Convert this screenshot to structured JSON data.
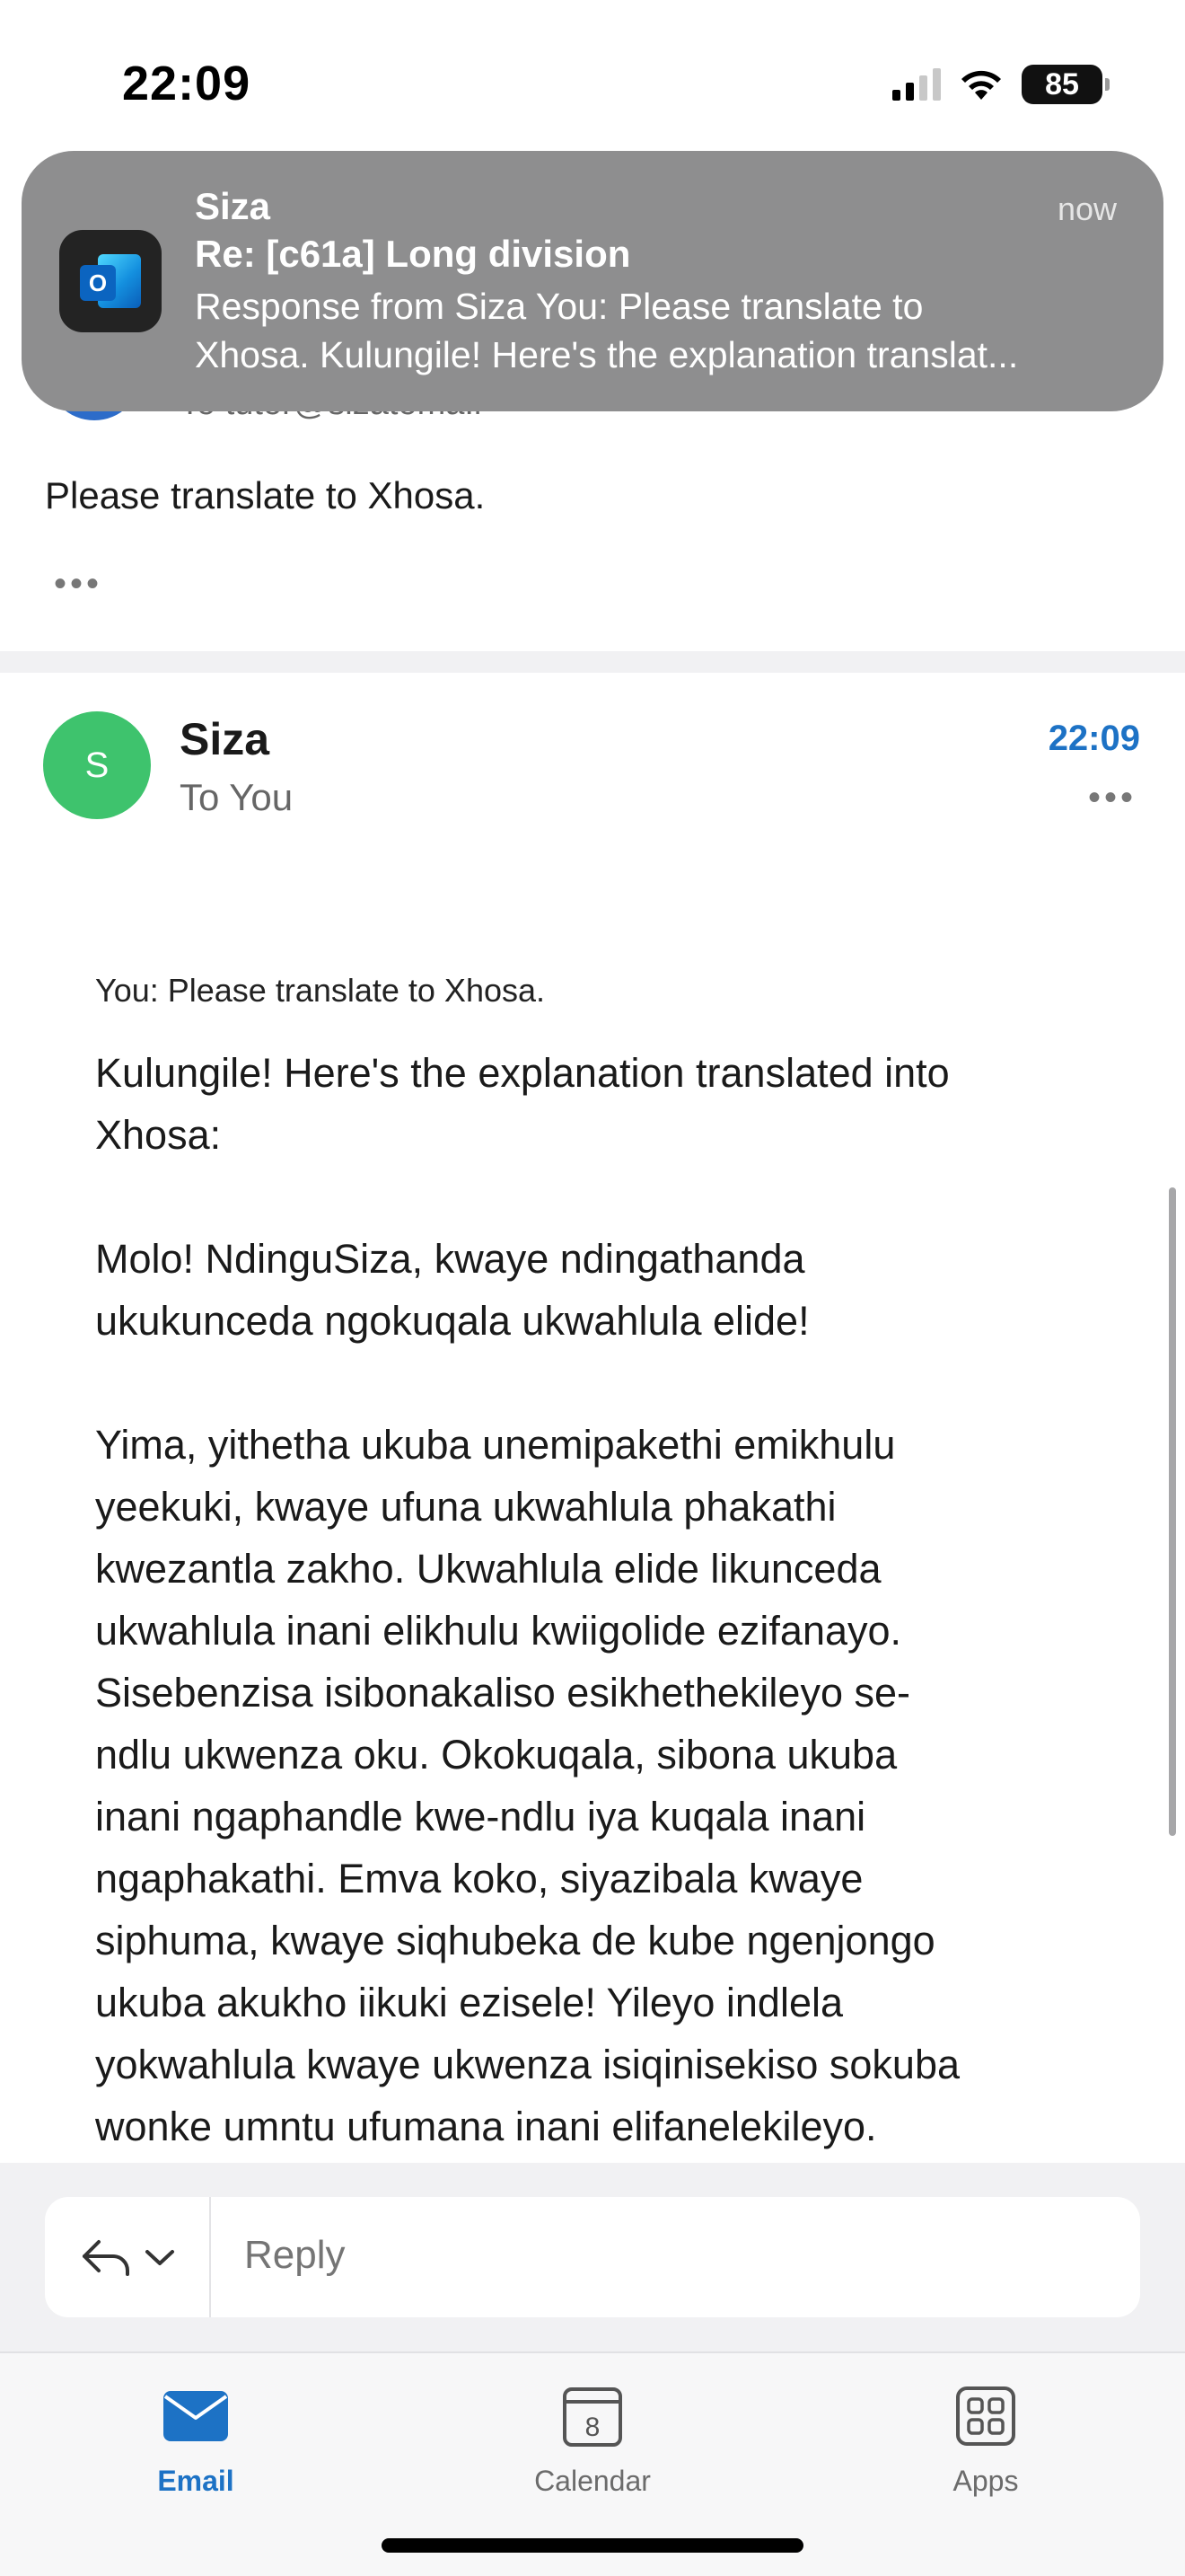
{
  "status_bar": {
    "time": "22:09",
    "battery": "85"
  },
  "notification": {
    "app": "Siza",
    "time": "now",
    "title": "Re: [c61a] Long division",
    "body_line1": "Response from Siza You: Please translate to",
    "body_line2": "Xhosa. Kulungile! Here's the explanation translat...",
    "icon": "outlook-icon",
    "icon_letter": "O"
  },
  "previous_message": {
    "recipient_partial": "To tutor@sizatoma.l",
    "body": "Please translate to Xhosa.",
    "more": "•••"
  },
  "message": {
    "avatar_initial": "S",
    "sender": "Siza",
    "recipient": "To You",
    "time": "22:09",
    "more": "•••",
    "quote": "You: Please translate to Xhosa.",
    "paragraphs": [
      "Kulungile! Here's the explanation translated into\nXhosa:",
      "Molo! NdinguSiza, kwaye ndingathanda\nukukunceda ngokuqala ukwahlula elide!",
      "Yima, yithetha ukuba unemipakethi emikhulu\nyeekuki, kwaye ufuna ukwahlula phakathi\nkwezantla zakho. Ukwahlula elide likunceda\nukwahlula inani elikhulu kwiigolide ezifanayo.\nSisebenzisa isibonakaliso esikhethekileyo se-\nndlu ukwenza oku. Okokuqala, sibona ukuba\ninani ngaphandle kwe-ndlu iya kuqala inani\nngaphakathi. Emva koko, siyazibala kwaye\nsiphuma, kwaye siqhubeka de kube ngenjongo\nukuba akukho iikuki ezisele! Yileyo indlela\nyokwahlula kwaye ukwenza isiqinisekiso sokuba\nwonke umntu ufumana inani elifanelekileyo."
    ]
  },
  "reply": {
    "placeholder": "Reply"
  },
  "tabs": [
    {
      "label": "Email",
      "icon": "envelope-icon",
      "active": true
    },
    {
      "label": "Calendar",
      "icon": "calendar-icon",
      "day": "8",
      "active": false
    },
    {
      "label": "Apps",
      "icon": "apps-grid-icon",
      "active": false
    }
  ],
  "colors": {
    "accent": "#1d72c5",
    "avatar": "#3ec36d",
    "notification_bg": "#8e8e8f"
  }
}
